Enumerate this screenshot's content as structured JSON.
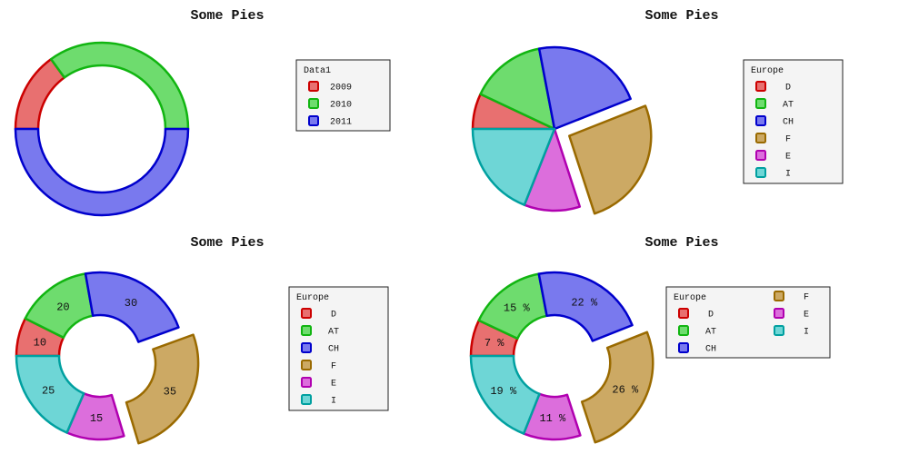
{
  "colors": {
    "red": {
      "fill": "#e87070",
      "stroke": "#cc0000"
    },
    "green": {
      "fill": "#6edc6e",
      "stroke": "#11b511"
    },
    "blue": {
      "fill": "#7979ee",
      "stroke": "#0000cc"
    },
    "tan": {
      "fill": "#cca964",
      "stroke": "#9a6a00"
    },
    "magenta": {
      "fill": "#dc6edc",
      "stroke": "#b000b0"
    },
    "cyan": {
      "fill": "#6ed6d6",
      "stroke": "#00a0a0"
    }
  },
  "chart_data": [
    {
      "type": "pie",
      "variant": "donut",
      "title": "Some Pies",
      "legend_title": "Data1",
      "categories": [
        "2009",
        "2010",
        "2011"
      ],
      "values": [
        15,
        35,
        50
      ],
      "colors": [
        "red",
        "green",
        "blue"
      ],
      "slice_labels": []
    },
    {
      "type": "pie",
      "variant": "exploded",
      "title": "Some Pies",
      "legend_title": "Europe",
      "categories": [
        "D",
        "AT",
        "CH",
        "F",
        "E",
        "I"
      ],
      "values": [
        7,
        15,
        22,
        26,
        11,
        19
      ],
      "colors": [
        "red",
        "green",
        "blue",
        "tan",
        "magenta",
        "cyan"
      ],
      "slice_labels": []
    },
    {
      "type": "pie",
      "variant": "exploded-donut",
      "title": "Some Pies",
      "legend_title": "Europe",
      "categories": [
        "D",
        "AT",
        "CH",
        "F",
        "E",
        "I"
      ],
      "values": [
        10,
        20,
        30,
        35,
        15,
        25
      ],
      "colors": [
        "red",
        "green",
        "blue",
        "tan",
        "magenta",
        "cyan"
      ],
      "slice_labels": [
        "10",
        "20",
        "30",
        "35",
        "15",
        "25"
      ]
    },
    {
      "type": "pie",
      "variant": "exploded-donut",
      "title": "Some Pies",
      "legend_title": "Europe",
      "legend_columns": 2,
      "categories": [
        "D",
        "AT",
        "CH",
        "F",
        "E",
        "I"
      ],
      "values": [
        7,
        15,
        22,
        26,
        11,
        19
      ],
      "colors": [
        "red",
        "green",
        "blue",
        "tan",
        "magenta",
        "cyan"
      ],
      "slice_labels": [
        "7 %",
        "15 %",
        "22 %",
        "26 %",
        "11 %",
        "19 %"
      ]
    }
  ]
}
